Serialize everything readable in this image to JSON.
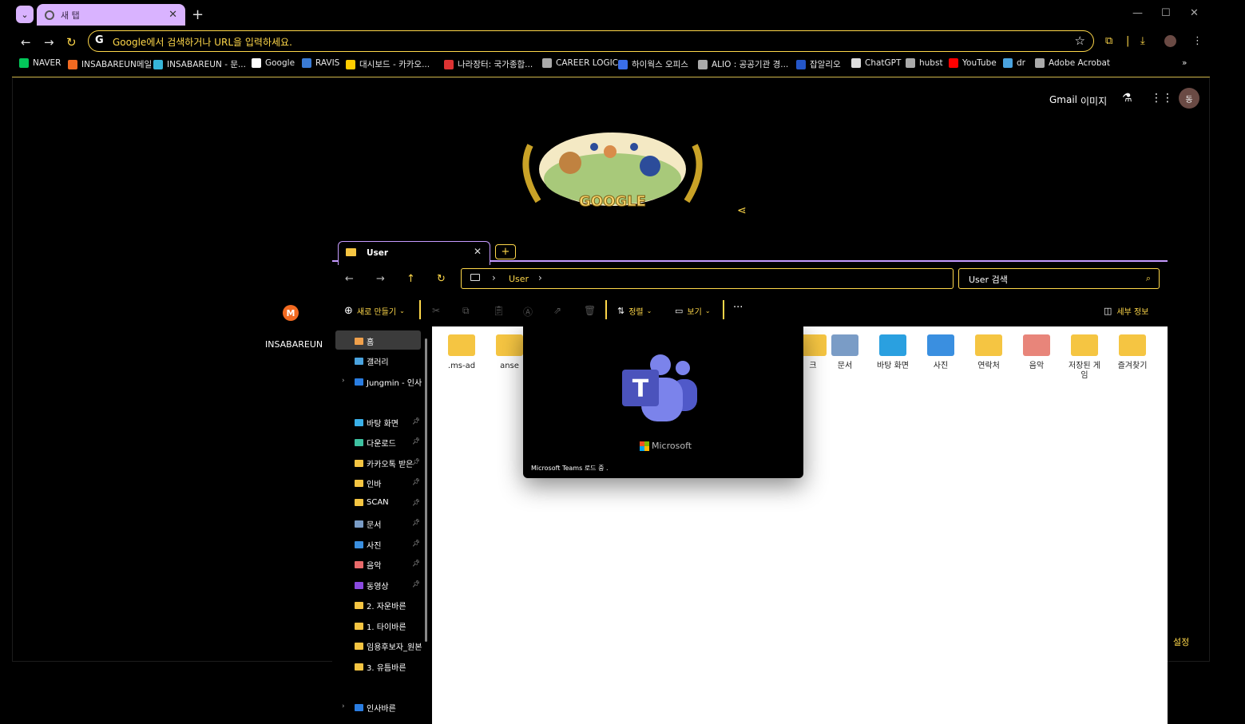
{
  "browser": {
    "tab_title": "새 탭",
    "omnibox_placeholder": "Google에서 검색하거나 URL을 입력하세요.",
    "bookmarks": [
      {
        "label": "NAVER",
        "color": "#03c75a"
      },
      {
        "label": "INSABAREUN메일",
        "color": "#f26a21"
      },
      {
        "label": "INSABAREUN - 문...",
        "color": "#36b5d8"
      },
      {
        "label": "Google",
        "color": "#ffffff"
      },
      {
        "label": "RAVIS",
        "color": "#3a7bd5"
      },
      {
        "label": "대시보드 - 카카오...",
        "color": "#ffcd00"
      },
      {
        "label": "나라장터: 국가종합...",
        "color": "#d33"
      },
      {
        "label": "CAREER LOGIC",
        "color": "#aaaaaa"
      },
      {
        "label": "하이웍스 오피스",
        "color": "#3a6ee8"
      },
      {
        "label": "ALIO : 공공기관 경...",
        "color": "#aaaaaa"
      },
      {
        "label": "잡알리오",
        "color": "#2456c8"
      },
      {
        "label": "ChatGPT",
        "color": "#dddddd"
      },
      {
        "label": "hubst",
        "color": "#aaaaaa"
      },
      {
        "label": "YouTube",
        "color": "#ff0000"
      },
      {
        "label": "dr",
        "color": "#4aa3df"
      },
      {
        "label": "Adobe Acrobat",
        "color": "#aaaaaa"
      }
    ],
    "more_bookmarks": "»"
  },
  "google": {
    "gmail": "Gmail",
    "images": "이미지",
    "avatar_initial": "동",
    "doodle_text": "GOOGLE",
    "shortcut_label": "INSABAREUN",
    "shortcut_initial": "M",
    "settings": "설정"
  },
  "explorer": {
    "tab_label": "User",
    "breadcrumb": "User",
    "search_placeholder": "User 검색",
    "commands": {
      "new": "새로 만들기",
      "sort": "정렬",
      "view": "보기",
      "more": "···",
      "details": "세부 정보"
    },
    "sidebar": [
      {
        "label": "홈",
        "color": "#f0a04b",
        "pinned": false
      },
      {
        "label": "갤러리",
        "color": "#4aa3df",
        "pinned": false
      },
      {
        "label": "Jungmin - 인사바",
        "color": "#2a7de1",
        "pinned": false
      },
      {
        "label": "바탕 화면",
        "color": "#3ab0e8",
        "pinned": true
      },
      {
        "label": "다운로드",
        "color": "#3ec1a0",
        "pinned": true
      },
      {
        "label": "카카오톡 받은",
        "color": "#f5c542",
        "pinned": true
      },
      {
        "label": "인바",
        "color": "#f5c542",
        "pinned": true
      },
      {
        "label": "SCAN",
        "color": "#f5c542",
        "pinned": true
      },
      {
        "label": "문서",
        "color": "#7a9cc6",
        "pinned": true
      },
      {
        "label": "사진",
        "color": "#3a8fe0",
        "pinned": true
      },
      {
        "label": "음악",
        "color": "#e86a6a",
        "pinned": true
      },
      {
        "label": "동영상",
        "color": "#8a4ae0",
        "pinned": true
      },
      {
        "label": "2. 자운바른",
        "color": "#f5c542",
        "pinned": false
      },
      {
        "label": "1. 타이바른",
        "color": "#f5c542",
        "pinned": false
      },
      {
        "label": "임용후보자_원본",
        "color": "#f5c542",
        "pinned": false
      },
      {
        "label": "3. 유틈바른",
        "color": "#f5c542",
        "pinned": false
      },
      {
        "label": "인사바른",
        "color": "#2a7de1",
        "pinned": false
      }
    ],
    "folders": [
      {
        "label": ".ms-ad",
        "color": "#f5c542"
      },
      {
        "label": "anse",
        "color": "#f5c542"
      },
      {
        "label": "크",
        "color": "#f5c542"
      },
      {
        "label": "문서",
        "color": "#7a9cc6"
      },
      {
        "label": "바탕 화면",
        "color": "#2aa0e0"
      },
      {
        "label": "사진",
        "color": "#3a8fe0"
      },
      {
        "label": "연락처",
        "color": "#f5c542"
      },
      {
        "label": "음악",
        "color": "#e8857a"
      },
      {
        "label": "저장된 게임",
        "color": "#f5c542"
      },
      {
        "label": "즐겨찾기",
        "color": "#f5c542"
      }
    ]
  },
  "teams_splash": {
    "brand": "Microsoft",
    "status": "Microsoft Teams 로드 중 ."
  }
}
